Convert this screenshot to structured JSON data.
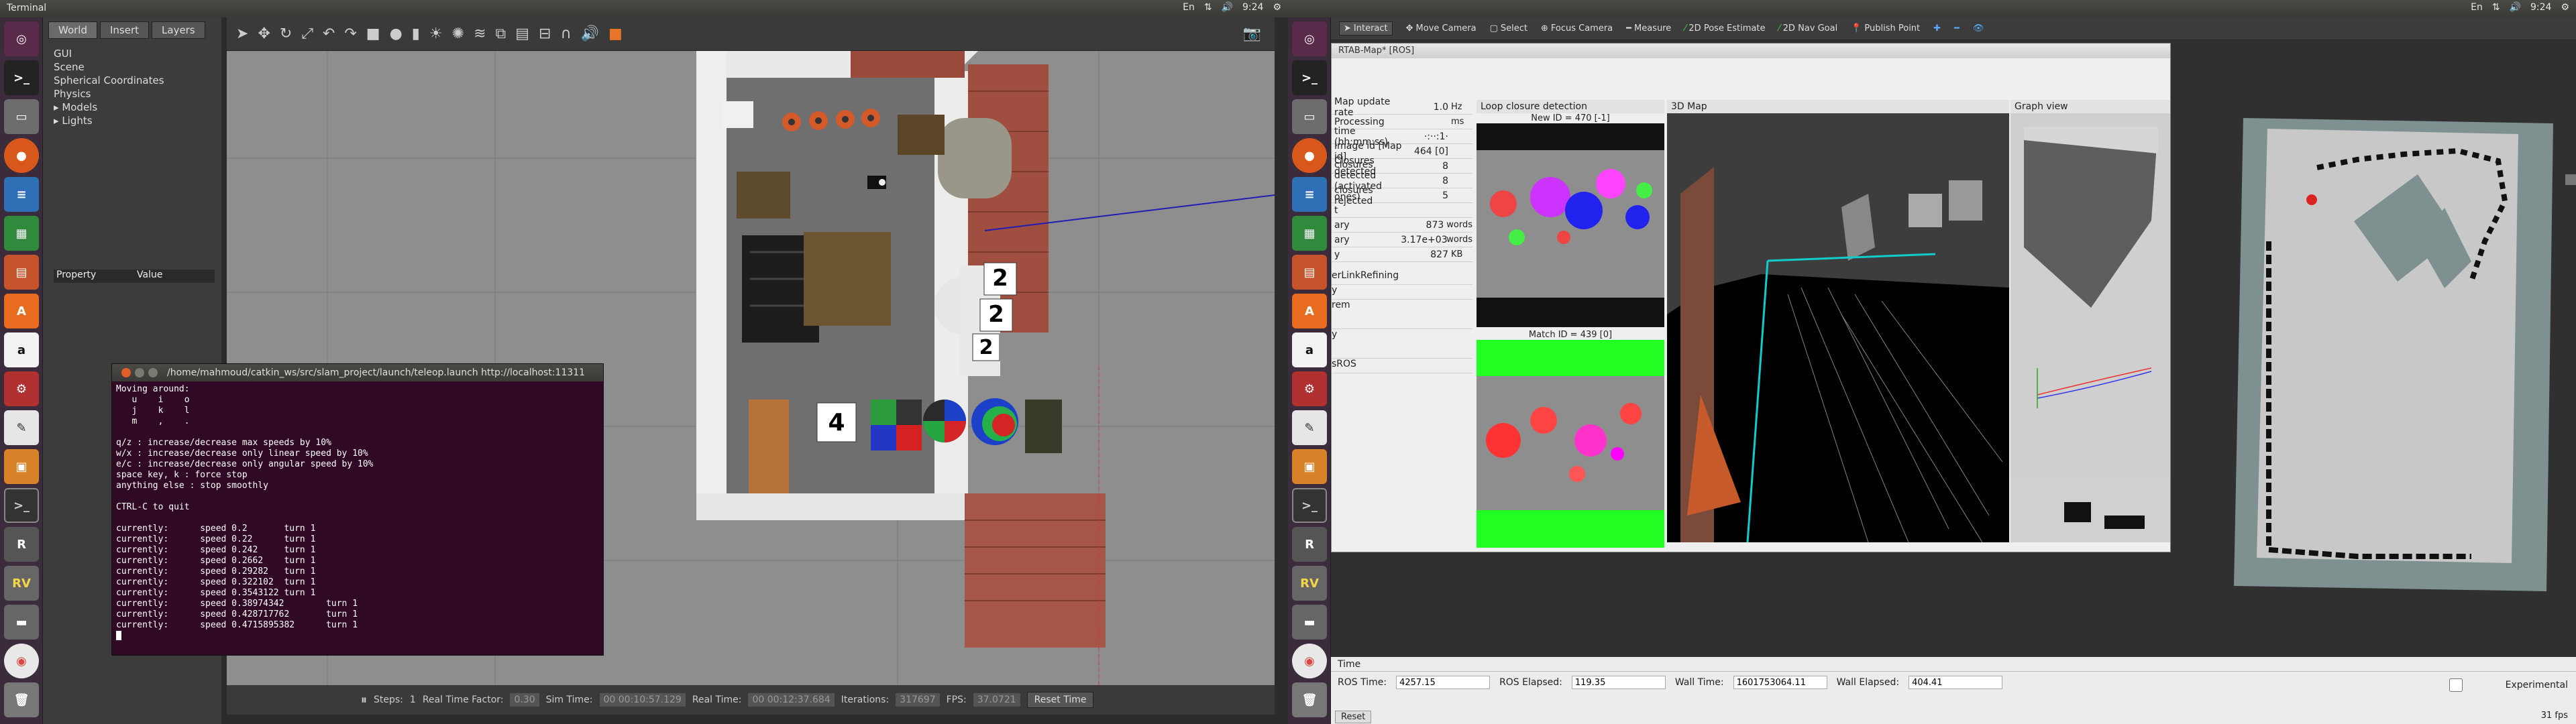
{
  "left": {
    "topbar": {
      "title": "Terminal",
      "tray": [
        "En",
        "⇅",
        "🔊",
        "9:24",
        "⚙"
      ]
    },
    "launcher_icons": [
      "dash",
      "terminal",
      "files",
      "firefox",
      "writer",
      "calc",
      "impress",
      "software",
      "amazon",
      "settings",
      "texteditor",
      "terminal2",
      "rviz",
      "gazebo",
      "rviz2",
      "disk",
      "chrome",
      "sublime",
      "trash"
    ],
    "gazebo": {
      "tabs": [
        "World",
        "Insert",
        "Layers"
      ],
      "tree": [
        "GUI",
        "Scene",
        "Spherical Coordinates",
        "Physics",
        "Models",
        "Lights"
      ],
      "prop_headers": [
        "Property",
        "Value"
      ],
      "bottom": {
        "pause": "⏸",
        "steps_label": "Steps:",
        "steps_value": "1",
        "rtf_label": "Real Time Factor:",
        "rtf_value": "0.30",
        "sim_label": "Sim Time:",
        "sim_value": "00 00:10:57.129",
        "real_label": "Real Time:",
        "real_value": "00 00:12:37.684",
        "iter_label": "Iterations:",
        "iter_value": "317697",
        "fps_label": "FPS:",
        "fps_value": "37.0721",
        "reset": "Reset Time"
      },
      "scene_labels": {
        "n1": "2",
        "n2": "2",
        "n3": "2",
        "n4": "4"
      }
    },
    "terminal": {
      "title": "/home/mahmoud/catkin_ws/src/slam_project/launch/teleop.launch http://localhost:11311",
      "lines": [
        "Moving around:",
        "   u    i    o",
        "   j    k    l",
        "   m    ,    .",
        "",
        "q/z : increase/decrease max speeds by 10%",
        "w/x : increase/decrease only linear speed by 10%",
        "e/c : increase/decrease only angular speed by 10%",
        "space key, k : force stop",
        "anything else : stop smoothly",
        "",
        "CTRL-C to quit",
        "",
        "currently:      speed 0.2       turn 1",
        "currently:      speed 0.22      turn 1",
        "currently:      speed 0.242     turn 1",
        "currently:      speed 0.2662    turn 1",
        "currently:      speed 0.29282   turn 1",
        "currently:      speed 0.322102  turn 1",
        "currently:      speed 0.3543122 turn 1",
        "currently:      speed 0.38974342        turn 1",
        "currently:      speed 0.428717762       turn 1",
        "currently:      speed 0.4715895382      turn 1"
      ]
    }
  },
  "right": {
    "topbar": {
      "tray": [
        "En",
        "⇅",
        "🔊",
        "9:24",
        "⚙"
      ]
    },
    "toolbar": [
      "Interact",
      "Move Camera",
      "Select",
      "Focus Camera",
      "Measure",
      "2D Pose Estimate",
      "2D Nav Goal",
      "Publish Point"
    ],
    "rtabmap": {
      "title": "RTAB-Map* [ROS]",
      "stats": [
        {
          "label": "Map update rate",
          "value": "1.0",
          "unit": "Hz"
        },
        {
          "label": "Processing",
          "value": "",
          "unit": "ms"
        },
        {
          "label": "time (hh:mm:ss)",
          "value": "·:··:1·",
          "unit": ""
        },
        {
          "label": "Image id [Map id]",
          "value": "464 [0]",
          "unit": ""
        },
        {
          "label": "Closures detected",
          "value": "8",
          "unit": ""
        },
        {
          "label": "closures detected (activated ones)",
          "value": "8",
          "unit": ""
        },
        {
          "label": "closures rejected",
          "value": "5",
          "unit": ""
        },
        {
          "label": "t",
          "value": "",
          "unit": ""
        },
        {
          "label": "ary",
          "value": "873",
          "unit": "words"
        },
        {
          "label": "ary",
          "value": "3.17e+03",
          "unit": "words"
        },
        {
          "label": "y",
          "value": "827",
          "unit": "KB"
        }
      ],
      "side_items": [
        "erLinkRefining",
        "y",
        "rem",
        "y",
        "sROS"
      ],
      "loop_title": "Loop closure detection",
      "new_id": "New ID = 470 [-1]",
      "match_id": "Match ID = 439 [0]",
      "map3d_title": "3D Map",
      "graph_title": "Graph view"
    },
    "time": {
      "header": "Time",
      "ros_time_label": "ROS Time:",
      "ros_time": "4257.15",
      "ros_elapsed_label": "ROS Elapsed:",
      "ros_elapsed": "119.35",
      "wall_time_label": "Wall Time:",
      "wall_time": "1601753064.11",
      "wall_elapsed_label": "Wall Elapsed:",
      "wall_elapsed": "404.41",
      "experimental": "Experimental",
      "reset": "Reset",
      "fps": "31 fps"
    }
  }
}
